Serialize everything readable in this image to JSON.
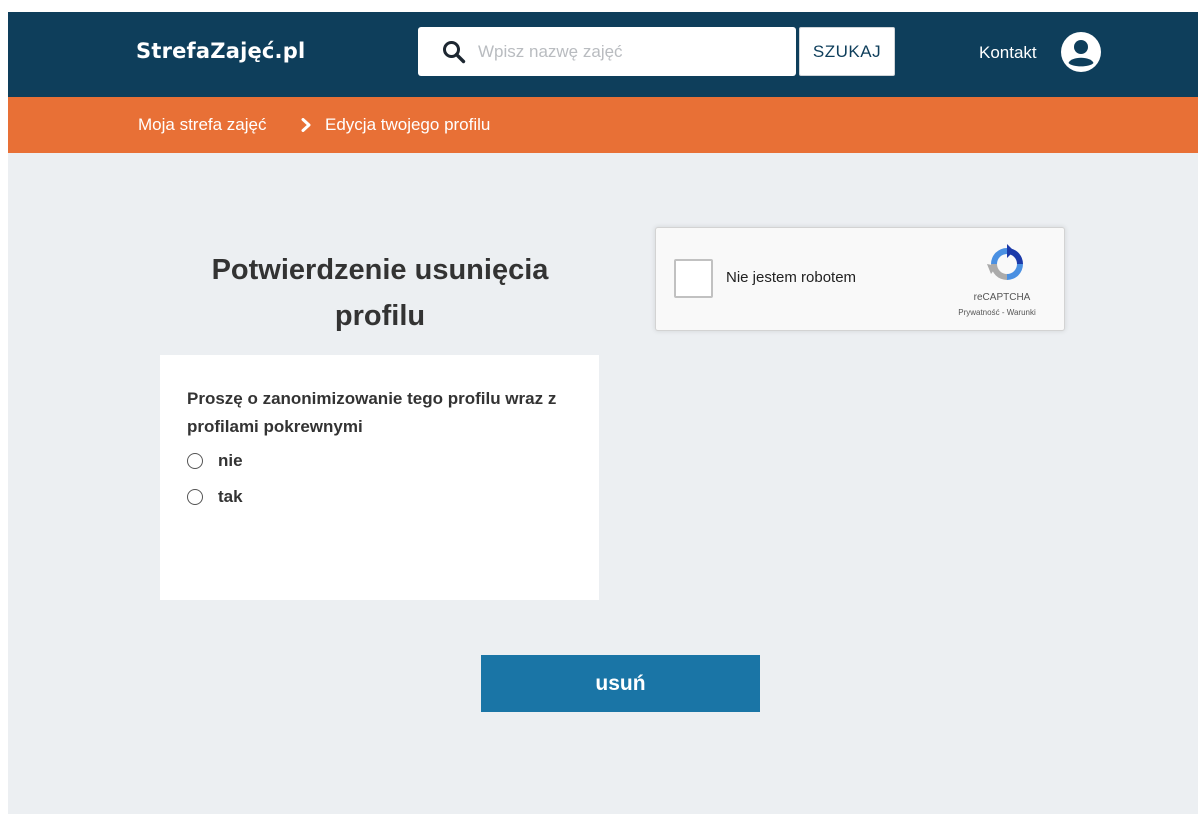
{
  "header": {
    "logo": "StrefaZajęć.pl",
    "search_placeholder": "Wpisz nazwę zajęć",
    "search_button": "SZUKAJ",
    "contact": "Kontakt"
  },
  "breadcrumb": {
    "items": [
      "Moja strefa zajęć",
      "Edycja twojego profilu"
    ]
  },
  "main": {
    "title_line1": "Potwierdzenie usunięcia",
    "title_line2": "profilu",
    "question": "Proszę o zanonimizowanie tego profilu wraz z profilami pokrewnymi",
    "options": [
      "nie",
      "tak"
    ],
    "submit": "usuń"
  },
  "recaptcha": {
    "label": "Nie jestem robotem",
    "brand": "reCAPTCHA",
    "privacy": "Prywatność",
    "separator": " - ",
    "terms": "Warunki"
  },
  "colors": {
    "header_bg": "#0e3e5b",
    "breadcrumb_bg": "#e87036",
    "page_bg": "#eceff2",
    "button_bg": "#1a75a6"
  },
  "icons": {
    "search": "search-icon",
    "user": "user-circle-icon",
    "chevron": "chevron-right-icon",
    "recaptcha": "recaptcha-logo-icon"
  }
}
